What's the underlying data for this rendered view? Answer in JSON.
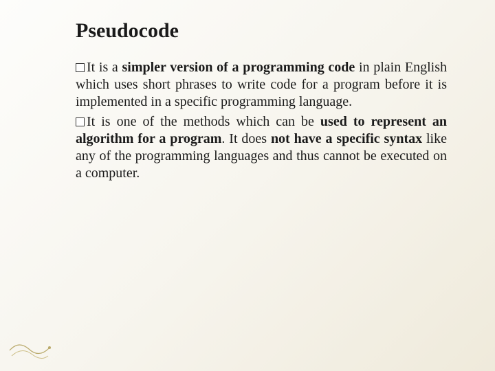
{
  "slide": {
    "title": "Pseudocode",
    "bullets": [
      {
        "seg1": "It is a ",
        "seg2_bold": "simpler version of a programming code",
        "seg3": " in plain English which uses short phrases to write code for a program before it is implemented in a specific programming language."
      },
      {
        "seg1": "It is one of the methods which can be ",
        "seg2_bold": "used to represent an algorithm for a program",
        "seg3": ". It does ",
        "seg4_bold": "not have a specific syntax",
        "seg5": " like any of the programming languages and thus cannot be executed on a computer."
      }
    ]
  }
}
